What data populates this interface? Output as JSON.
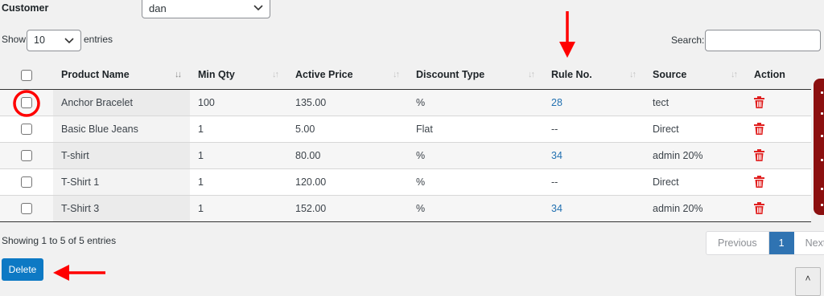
{
  "filters": {
    "customer_label": "Customer",
    "customer_value": "dan",
    "show_label": "Show",
    "length_value": "10",
    "entries_label": "entries",
    "search_label": "Search:",
    "search_value": ""
  },
  "table": {
    "columns": [
      "Product Name",
      "Min Qty",
      "Active Price",
      "Discount Type",
      "Rule No.",
      "Source",
      "Action"
    ],
    "rows": [
      {
        "product": "Anchor Bracelet",
        "min_qty": "100",
        "price": "135.00",
        "discount": "%",
        "rule": "28",
        "source": "tect"
      },
      {
        "product": "Basic Blue Jeans",
        "min_qty": "1",
        "price": "5.00",
        "discount": "Flat",
        "rule": "--",
        "source": "Direct"
      },
      {
        "product": "T-shirt",
        "min_qty": "1",
        "price": "80.00",
        "discount": "%",
        "rule": "34",
        "source": "admin 20%"
      },
      {
        "product": "T-Shirt 1",
        "min_qty": "1",
        "price": "120.00",
        "discount": "%",
        "rule": "--",
        "source": "Direct"
      },
      {
        "product": "T-Shirt 3",
        "min_qty": "1",
        "price": "152.00",
        "discount": "%",
        "rule": "34",
        "source": "admin 20%"
      }
    ]
  },
  "footer": {
    "info": "Showing 1 to 5 of 5 entries",
    "previous": "Previous",
    "current_page": "1",
    "next": "Next",
    "delete_label": "Delete",
    "scroll_top": "˄"
  },
  "colors": {
    "accent": "#2271b1",
    "delete_button": "#0d79c4",
    "trash_icon": "#e02020",
    "side_tab": "#8b0f0f",
    "annotation": "#ff0000"
  }
}
